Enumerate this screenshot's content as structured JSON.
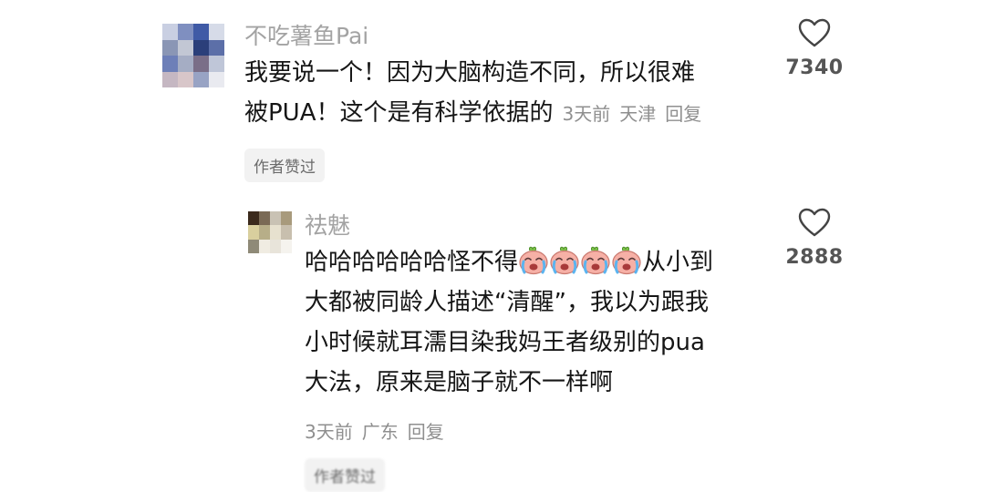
{
  "comments": [
    {
      "username": "不吃薯鱼Pai",
      "text_line1": "我要说一个！因为大脑构造不同，所以很难",
      "text_line2": "被PUA！这个是有科学依据的",
      "meta": {
        "time": "3天前",
        "location": "天津",
        "reply": "回复"
      },
      "tag": "作者赞过",
      "likes": "7340",
      "avatar_colors": [
        "#c9cfe2",
        "#7f8fc0",
        "#3f5aa6",
        "#d6dbe8",
        "#8a96b5",
        "#c2c7d4",
        "#2b3f7a",
        "#5c6fa8",
        "#6d7fb8",
        "#a5adc4",
        "#7a6e88",
        "#bfc6d8",
        "#c5b7c2",
        "#d8c6c9",
        "#98a3c4",
        "#e9eaf0"
      ]
    },
    {
      "username": "祛魅",
      "text_line1": "哈哈哈哈哈哈怪不得",
      "text_line1_after": "从小到",
      "text_line2": "大都被同龄人描述“清醒”，我以为跟我",
      "text_line3": "小时候就耳濡目染我妈王者级别的pua",
      "text_line4": "大法，原来是脑子就不一样啊",
      "meta": {
        "time": "3天前",
        "location": "广东",
        "reply": "回复"
      },
      "tag": "作者赞过",
      "likes": "2888",
      "emoji_count": 4,
      "emoji": "crying-face-emoji",
      "avatar_colors": [
        "#3b2a1c",
        "#7a6a55",
        "#c9c2b4",
        "#a89a7c",
        "#d9cf9e",
        "#b7ae88",
        "#e7e1cf",
        "#c8bfae",
        "#8f8a78",
        "#f0ece2",
        "#e8e4da",
        "#f5f3ee"
      ]
    }
  ],
  "colors": {
    "username": "#a3a3a3",
    "text": "#161616",
    "meta": "#8f8f8f",
    "tag_bg": "#f2f2f2",
    "like_count": "#555555"
  }
}
